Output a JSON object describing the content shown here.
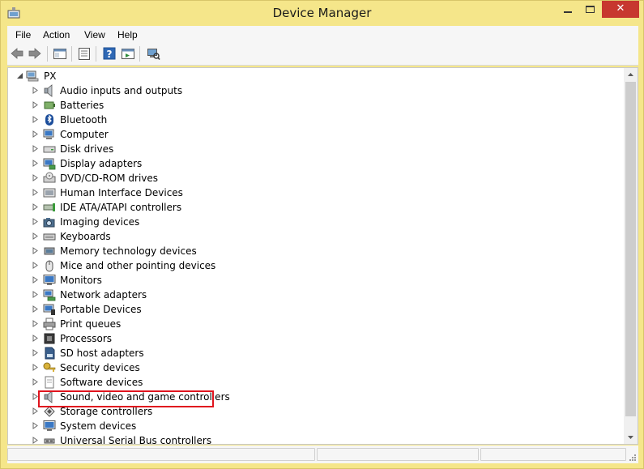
{
  "window": {
    "title": "Device Manager",
    "close_glyph": "✕"
  },
  "menu": [
    "File",
    "Action",
    "View",
    "Help"
  ],
  "toolbar": {
    "buttons": [
      "back-icon",
      "forward-icon",
      "console-tree-icon",
      "properties-icon",
      "help-icon",
      "action-pane-icon",
      "scan-hardware-icon"
    ]
  },
  "tree": {
    "root": "PX",
    "items": [
      {
        "label": "Audio inputs and outputs",
        "icon": "speaker-icon"
      },
      {
        "label": "Batteries",
        "icon": "battery-icon"
      },
      {
        "label": "Bluetooth",
        "icon": "bluetooth-icon"
      },
      {
        "label": "Computer",
        "icon": "computer-icon"
      },
      {
        "label": "Disk drives",
        "icon": "disk-drive-icon"
      },
      {
        "label": "Display adapters",
        "icon": "display-adapter-icon"
      },
      {
        "label": "DVD/CD-ROM drives",
        "icon": "dvd-drive-icon"
      },
      {
        "label": "Human Interface Devices",
        "icon": "hid-icon"
      },
      {
        "label": "IDE ATA/ATAPI controllers",
        "icon": "ide-controller-icon"
      },
      {
        "label": "Imaging devices",
        "icon": "camera-icon"
      },
      {
        "label": "Keyboards",
        "icon": "keyboard-icon"
      },
      {
        "label": "Memory technology devices",
        "icon": "memory-icon"
      },
      {
        "label": "Mice and other pointing devices",
        "icon": "mouse-icon"
      },
      {
        "label": "Monitors",
        "icon": "monitor-icon"
      },
      {
        "label": "Network adapters",
        "icon": "network-adapter-icon"
      },
      {
        "label": "Portable Devices",
        "icon": "portable-device-icon"
      },
      {
        "label": "Print queues",
        "icon": "printer-icon"
      },
      {
        "label": "Processors",
        "icon": "processor-icon"
      },
      {
        "label": "SD host adapters",
        "icon": "sd-card-icon"
      },
      {
        "label": "Security devices",
        "icon": "key-icon"
      },
      {
        "label": "Software devices",
        "icon": "software-device-icon"
      },
      {
        "label": "Sound, video and game controllers",
        "icon": "speaker-icon"
      },
      {
        "label": "Storage controllers",
        "icon": "storage-controller-icon"
      },
      {
        "label": "System devices",
        "icon": "system-device-icon"
      },
      {
        "label": "Universal Serial Bus controllers",
        "icon": "usb-icon"
      }
    ],
    "highlighted_index": 21
  },
  "colors": {
    "frame": "#f5e68a",
    "close": "#c7372f",
    "highlight_border": "#e0141e"
  }
}
